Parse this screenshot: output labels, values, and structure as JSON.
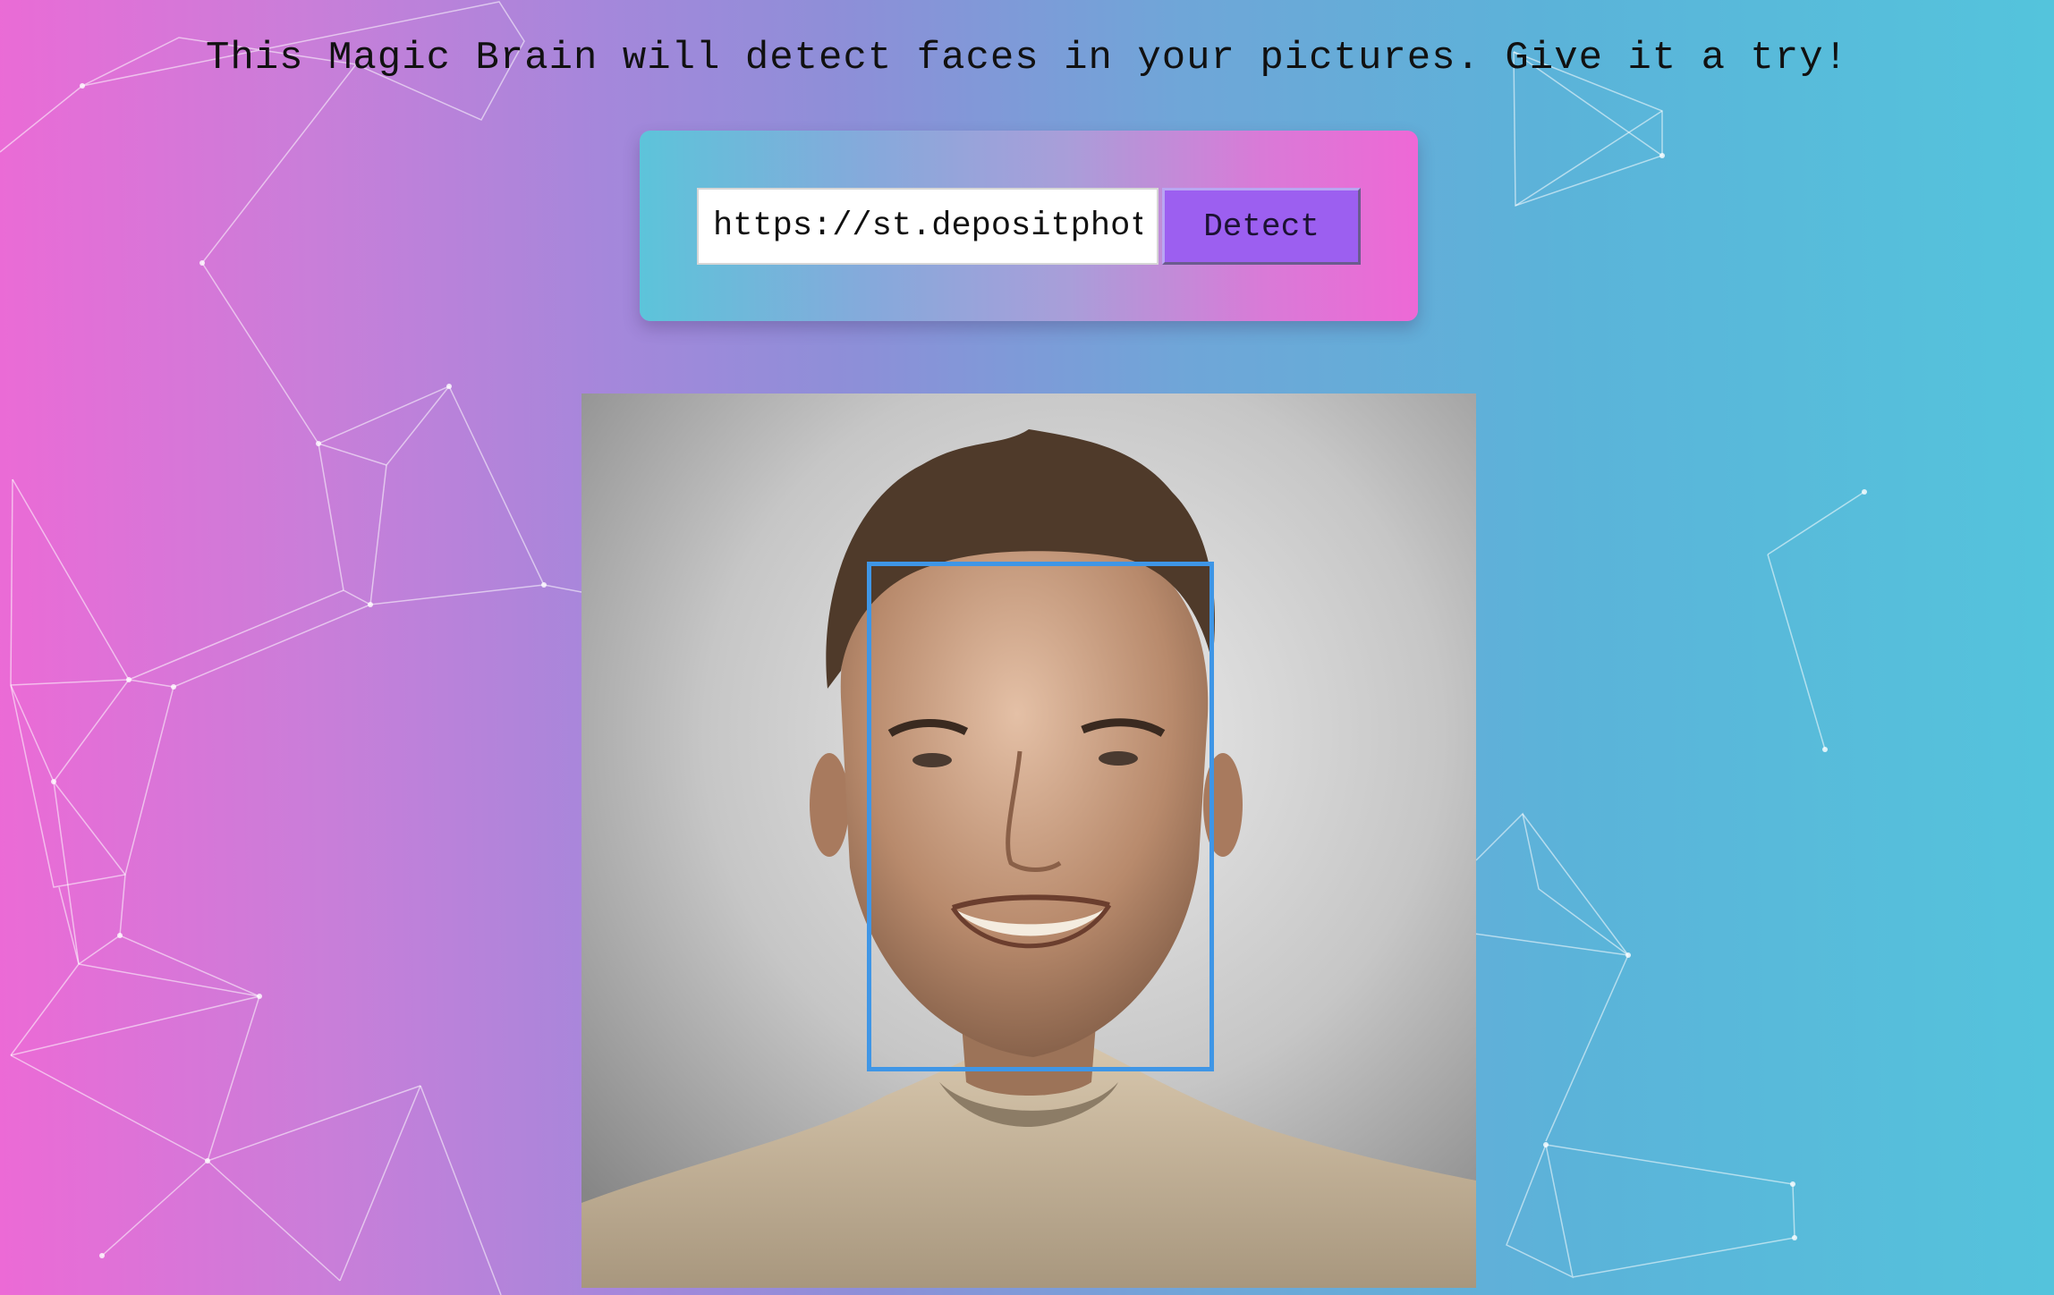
{
  "header": {
    "headline": "This Magic Brain will detect faces in your pictures. Give it a try!"
  },
  "form": {
    "url_value": "https://st.depositphotos.com/",
    "detect_label": "Detect"
  },
  "result": {
    "photo_alt": "portrait photo of a smiling man",
    "face_box_color": "#3f96e6"
  },
  "colors": {
    "background_left": "#ec6ad6",
    "background_right": "#54c4dc",
    "button": "#9c5ff0"
  }
}
